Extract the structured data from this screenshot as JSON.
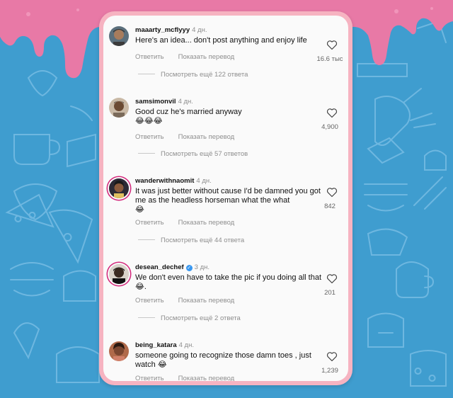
{
  "actions": {
    "reply": "Ответить",
    "translate": "Показать перевод"
  },
  "comments": [
    {
      "user": "maaarty_mcflyyy",
      "time": "4 дн.",
      "text": "Here's an idea... don't post anything and enjoy life",
      "emoji": "",
      "likes": "16.6 тыс",
      "replies": "Посмотреть ещё 122 ответа",
      "verified": false
    },
    {
      "user": "samsimonvil",
      "time": "4 дн.",
      "text": "Good cuz he's married anyway",
      "emoji": "😂😂😂",
      "likes": "4,900",
      "replies": "Посмотреть ещё 57 ответов",
      "verified": false
    },
    {
      "user": "wanderwithnaomit",
      "time": "4 дн.",
      "text": "It was just better without cause I'd be damned you got me as the headless horseman what the what",
      "emoji": "😂",
      "likes": "842",
      "replies": "Посмотреть ещё 44 ответа",
      "verified": false
    },
    {
      "user": "desean_dechef",
      "time": "3 дн.",
      "text": "We don't even have to take the pic if you doing all that",
      "emoji": "😂.",
      "likes": "201",
      "replies": "Посмотреть ещё 2 ответа",
      "verified": true
    },
    {
      "user": "being_katara",
      "time": "4 дн.",
      "text": "someone going to recognize those damn toes , just watch",
      "emoji": "😂",
      "likes": "1,239",
      "replies": "",
      "verified": false
    }
  ],
  "colors": {
    "background": "#3f9dcf",
    "drip": "#e879a6",
    "frame": "#f6b3c1",
    "panel": "#fafafa",
    "story_ring": "#d3267a",
    "verified": "#3897f0"
  },
  "icons": [
    "heart-icon",
    "verified-badge-icon"
  ]
}
